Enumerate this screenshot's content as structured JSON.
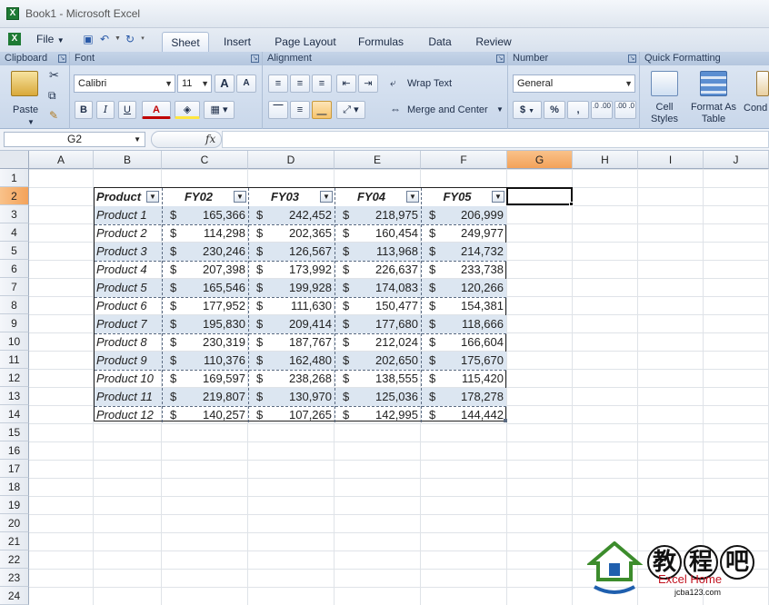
{
  "window": {
    "title": "Book1 - Microsoft Excel",
    "app_icon": "X"
  },
  "ribbon_tabs": {
    "file": "File",
    "tabs": [
      "Sheet",
      "Insert",
      "Page Layout",
      "Formulas",
      "Data",
      "Review"
    ],
    "active": "Sheet"
  },
  "ribbon": {
    "clipboard": {
      "label": "Clipboard",
      "paste": "Paste"
    },
    "font": {
      "label": "Font",
      "family": "Calibri",
      "size": "11",
      "bold": "B",
      "italic": "I",
      "underline": "U",
      "font_color": "A",
      "grow": "A",
      "shrink": "A"
    },
    "alignment": {
      "label": "Alignment",
      "wrap": "Wrap Text",
      "merge": "Merge and Center"
    },
    "number": {
      "label": "Number",
      "format": "General",
      "currency": "$",
      "percent": "%",
      "comma": ",",
      "inc_dec": ".0 .00",
      "dec_dec": ".00 .0"
    },
    "quick": {
      "label": "Quick Formatting",
      "cell_styles": "Cell Styles",
      "format_table": "Format As Table",
      "conditional": "Cond"
    }
  },
  "formula_bar": {
    "name_box": "G2",
    "fx": "fx",
    "value": ""
  },
  "columns": [
    "A",
    "B",
    "C",
    "D",
    "E",
    "F",
    "G",
    "H",
    "I",
    "J"
  ],
  "selected_column": "G",
  "rows": [
    "1",
    "2",
    "3",
    "4",
    "5",
    "6",
    "7",
    "8",
    "9",
    "10",
    "11",
    "12",
    "13",
    "14",
    "15",
    "16",
    "17",
    "18",
    "19",
    "20",
    "21",
    "22",
    "23",
    "24"
  ],
  "selected_row": "2",
  "table": {
    "headers": [
      "Product",
      "FY02",
      "FY03",
      "FY04",
      "FY05"
    ],
    "currency_symbol": "$",
    "rows": [
      [
        "Product 1",
        "165,366",
        "242,452",
        "218,975",
        "206,999"
      ],
      [
        "Product 2",
        "114,298",
        "202,365",
        "160,454",
        "249,977"
      ],
      [
        "Product 3",
        "230,246",
        "126,567",
        "113,968",
        "214,732"
      ],
      [
        "Product 4",
        "207,398",
        "173,992",
        "226,637",
        "233,738"
      ],
      [
        "Product 5",
        "165,546",
        "199,928",
        "174,083",
        "120,266"
      ],
      [
        "Product 6",
        "177,952",
        "111,630",
        "150,477",
        "154,381"
      ],
      [
        "Product 7",
        "195,830",
        "209,414",
        "177,680",
        "118,666"
      ],
      [
        "Product 8",
        "230,319",
        "187,767",
        "212,024",
        "166,604"
      ],
      [
        "Product 9",
        "110,376",
        "162,480",
        "202,650",
        "175,670"
      ],
      [
        "Product 10",
        "169,597",
        "238,268",
        "138,555",
        "115,420"
      ],
      [
        "Product 11",
        "219,807",
        "130,970",
        "125,036",
        "178,278"
      ],
      [
        "Product 12",
        "140,257",
        "107,265",
        "142,995",
        "144,442"
      ]
    ]
  },
  "watermark": {
    "chars": [
      "教",
      "程",
      "吧"
    ],
    "line1": "Excel Home",
    "line2": "jcba123.com"
  },
  "colors": {
    "accent": "#f3a25a",
    "band": "#dce6f1",
    "excel_green": "#1e7a34"
  }
}
